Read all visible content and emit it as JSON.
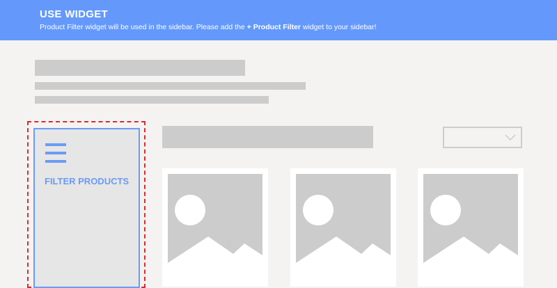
{
  "banner": {
    "title": "USE WIDGET",
    "text_before": "Product Filter widget will be used in the sidebar. Please add the ",
    "text_bold": "+ Product Filter",
    "text_after": " widget to your sidebar!",
    "color": "#6499fb"
  },
  "sidebar_widget": {
    "icon": "hamburger-menu-icon",
    "label": "FILTER PRODUCTS",
    "accent_color": "#6b9bf4",
    "highlight_border_color": "#d62b2b"
  },
  "sort_select": {
    "icon": "chevron-down-icon"
  },
  "products": [
    {
      "icon": "image-placeholder-icon"
    },
    {
      "icon": "image-placeholder-icon"
    },
    {
      "icon": "image-placeholder-icon"
    }
  ]
}
